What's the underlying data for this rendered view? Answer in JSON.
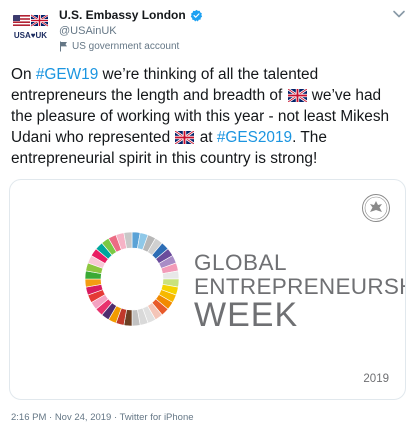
{
  "account": {
    "name": "U.S. Embassy London",
    "handle": "@USAinUK",
    "label": "US government account",
    "avatar_text": "USA♥UK",
    "verified_icon": "verified-badge-icon"
  },
  "tweet": {
    "segments": [
      {
        "text": "On ",
        "type": "text"
      },
      {
        "text": "#GEW19",
        "type": "hashtag"
      },
      {
        "text": " we’re thinking of all the talented entrepreneurs the length and breadth of ",
        "type": "text"
      },
      {
        "text": "uk-flag",
        "type": "flag"
      },
      {
        "text": " we’ve had the pleasure of working with this year - not least Mikesh Udani who represented ",
        "type": "text"
      },
      {
        "text": "uk-flag",
        "type": "flag"
      },
      {
        "text": " at ",
        "type": "text"
      },
      {
        "text": "#GES2019",
        "type": "hashtag"
      },
      {
        "text": ". The entrepreneurial spirit in this country is strong!",
        "type": "text"
      }
    ]
  },
  "card": {
    "line1": "GLOBAL",
    "line2": "ENTREPRENEURSHIP",
    "line3": "WEEK",
    "year": "2019",
    "wheel_colors": [
      "#5aa2d6",
      "#8fc8e8",
      "#b7b7b7",
      "#d0d0d0",
      "#2d6db5",
      "#6a4c9c",
      "#a88cc6",
      "#f29bb8",
      "#e8e8e8",
      "#c9e27c",
      "#f5d300",
      "#f7b800",
      "#f28a00",
      "#e85a2a",
      "#f4c5b8",
      "#e0e0e0",
      "#d9d9d9",
      "#c2c2c2",
      "#6b3f23",
      "#c0392b",
      "#f29b00",
      "#4e2d6e",
      "#e8326d",
      "#f4a3c2",
      "#e53935",
      "#d81b60",
      "#f39c12",
      "#3aaa35",
      "#8dc63f",
      "#f8c8d5",
      "#e91e63",
      "#00a79d",
      "#7ac943",
      "#ec6c84",
      "#f6b3c6",
      "#c8c8c8"
    ]
  },
  "meta": {
    "timestamp": "2:16 PM · Nov 24, 2019 · Twitter for iPhone"
  }
}
